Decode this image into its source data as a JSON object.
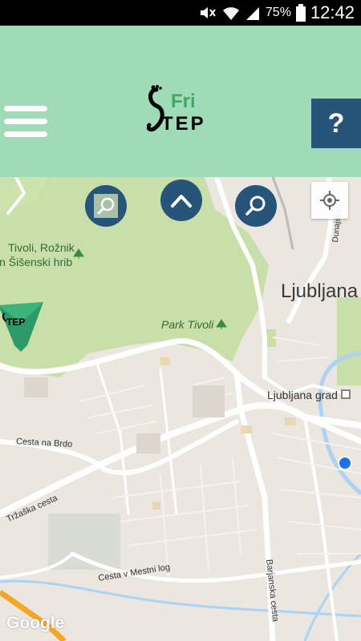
{
  "status_bar": {
    "battery_percent": "75%",
    "time": "12:42"
  },
  "header": {
    "logo": {
      "top_text": "Fri",
      "bottom_text": "TEP"
    },
    "menu_icon": "hamburger-menu-icon",
    "help_label": "?"
  },
  "map": {
    "controls": {
      "search_left_icon": "magnifier-icon",
      "collapse_icon": "chevron-up-icon",
      "search_right_icon": "magnifier-icon",
      "my_location_icon": "crosshair-icon"
    },
    "marker": {
      "text": "TEP"
    },
    "labels": {
      "tivoli_line1": "Tivoli, Rožnik",
      "tivoli_line2": "in Šišenski hrib",
      "park_tivoli": "Park Tivoli",
      "ljubljana": "Ljubljana",
      "ljubljana_grad": "Ljubljana grad",
      "cesta_na_brdo": "Cesta na Brdo",
      "trzaska_cesta": "Tržaška cesta",
      "cesta_v_mestni_log": "Cesta v Mestni log",
      "barjanska_cesta": "Barjanska cesta",
      "dunajska": "Dunajska c.",
      "google": "Google"
    },
    "colors": {
      "park": "#c9dfa9",
      "road": "#ffffff",
      "water": "#aad3f5",
      "highway": "#f5a623",
      "location_dot": "#1a73e8"
    }
  },
  "theme": {
    "header_bg": "#9edbb6",
    "button_bg": "#27557a"
  }
}
